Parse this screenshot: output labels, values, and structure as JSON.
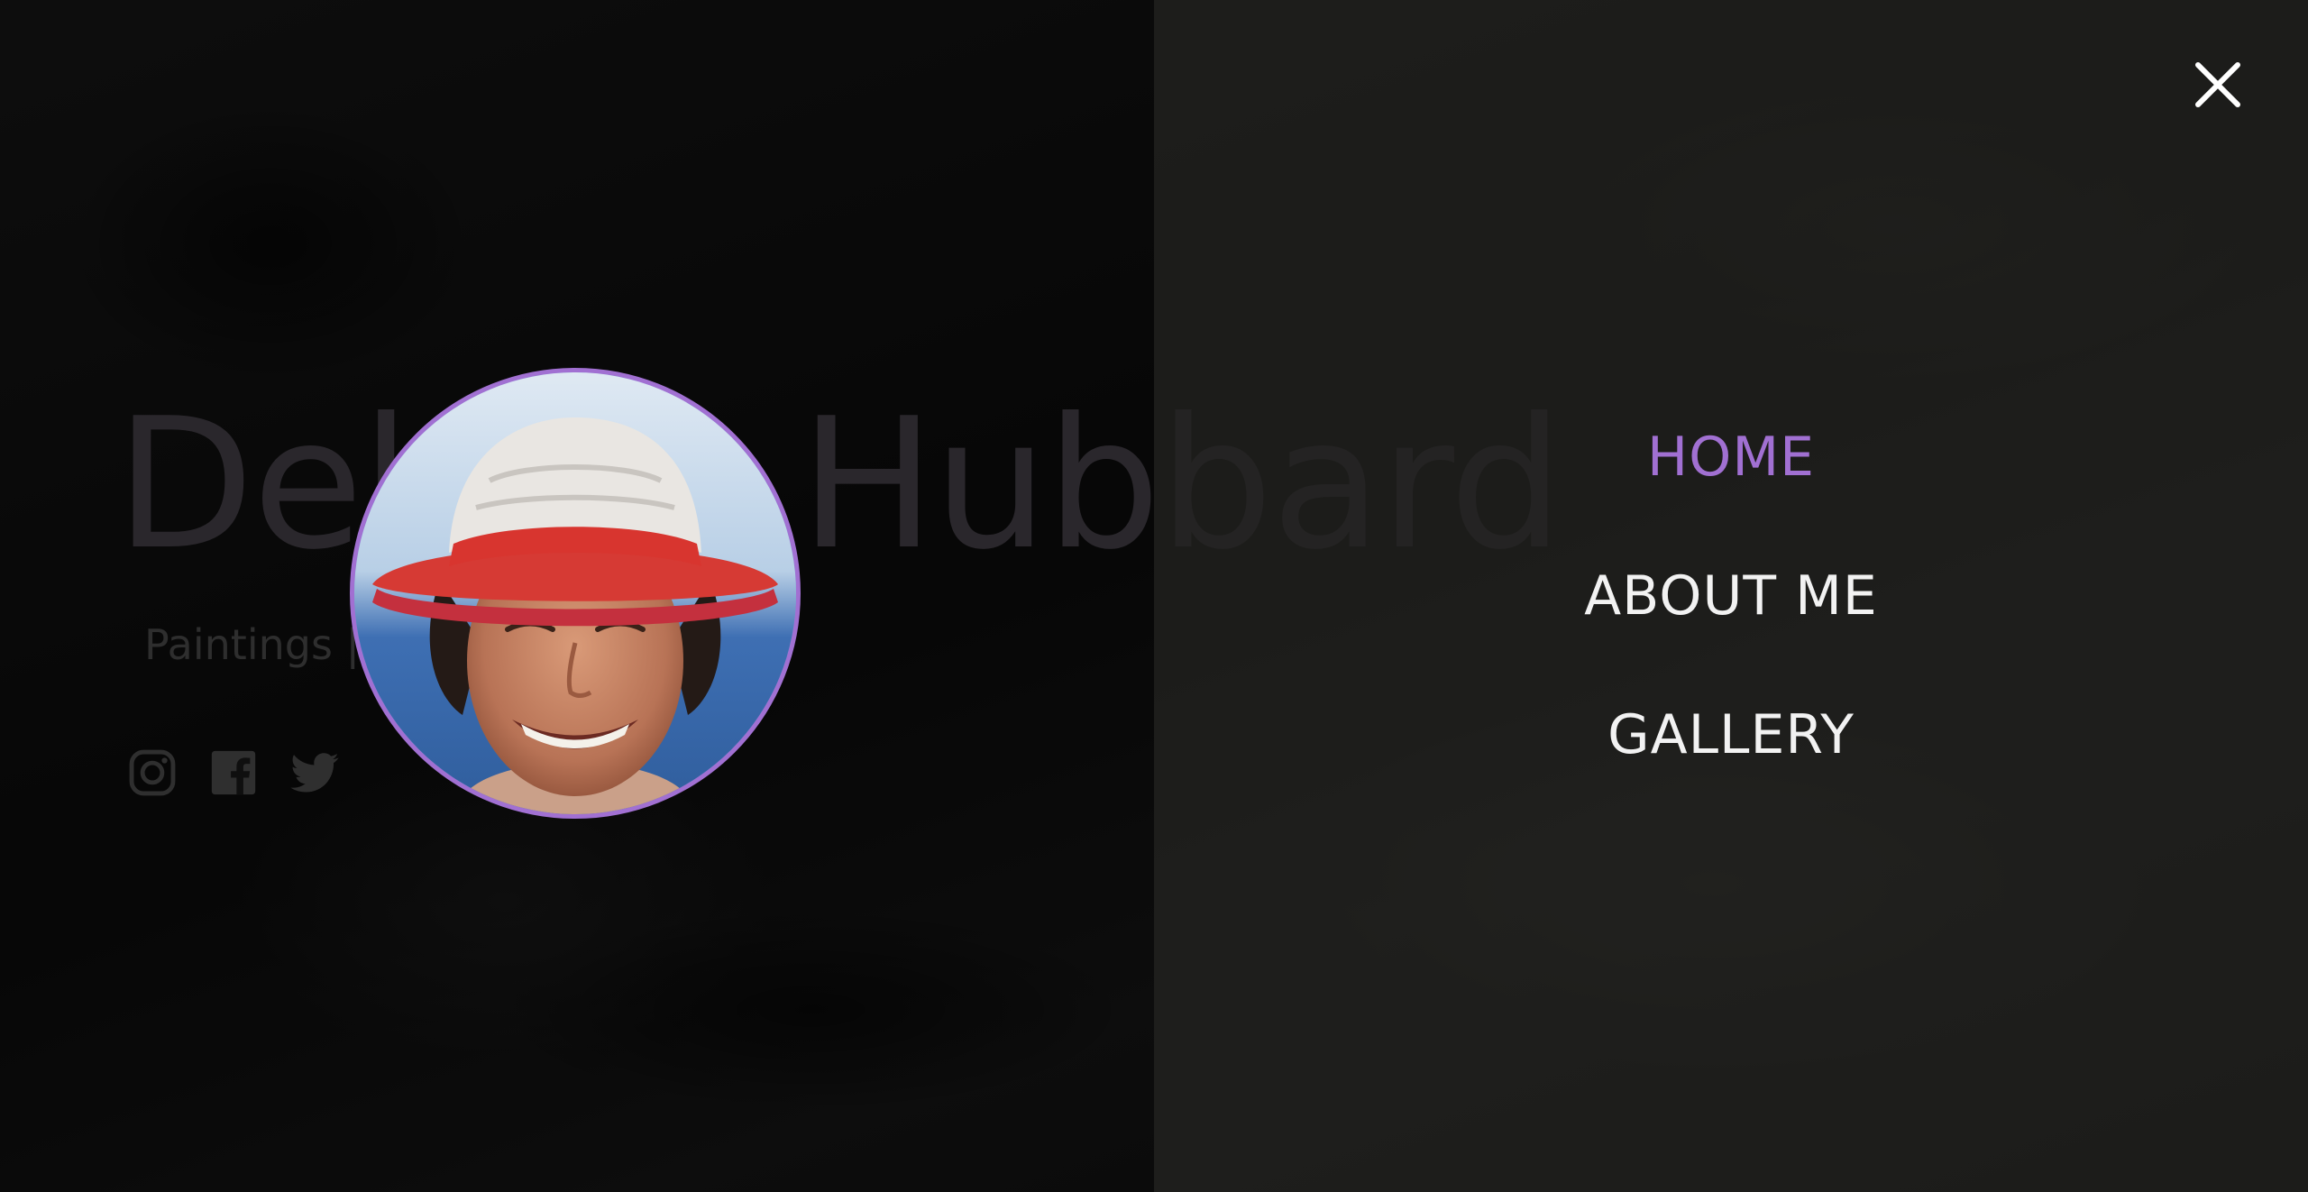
{
  "hero": {
    "title": "Debbie Hubbard",
    "subtitle": "Paintings | Sketches"
  },
  "social": [
    {
      "icon": "instagram-icon"
    },
    {
      "icon": "facebook-icon"
    },
    {
      "icon": "twitter-icon"
    }
  ],
  "avatar": {
    "icon": "profile-photo",
    "border_color": "#a170d2"
  },
  "menu": {
    "close_icon": "close-icon",
    "items": [
      {
        "label": "HOME",
        "active": true
      },
      {
        "label": "ABOUT ME",
        "active": false
      },
      {
        "label": "GALLERY",
        "active": false
      }
    ],
    "active_color": "#a170d2",
    "text_color": "#f2f2f2"
  }
}
